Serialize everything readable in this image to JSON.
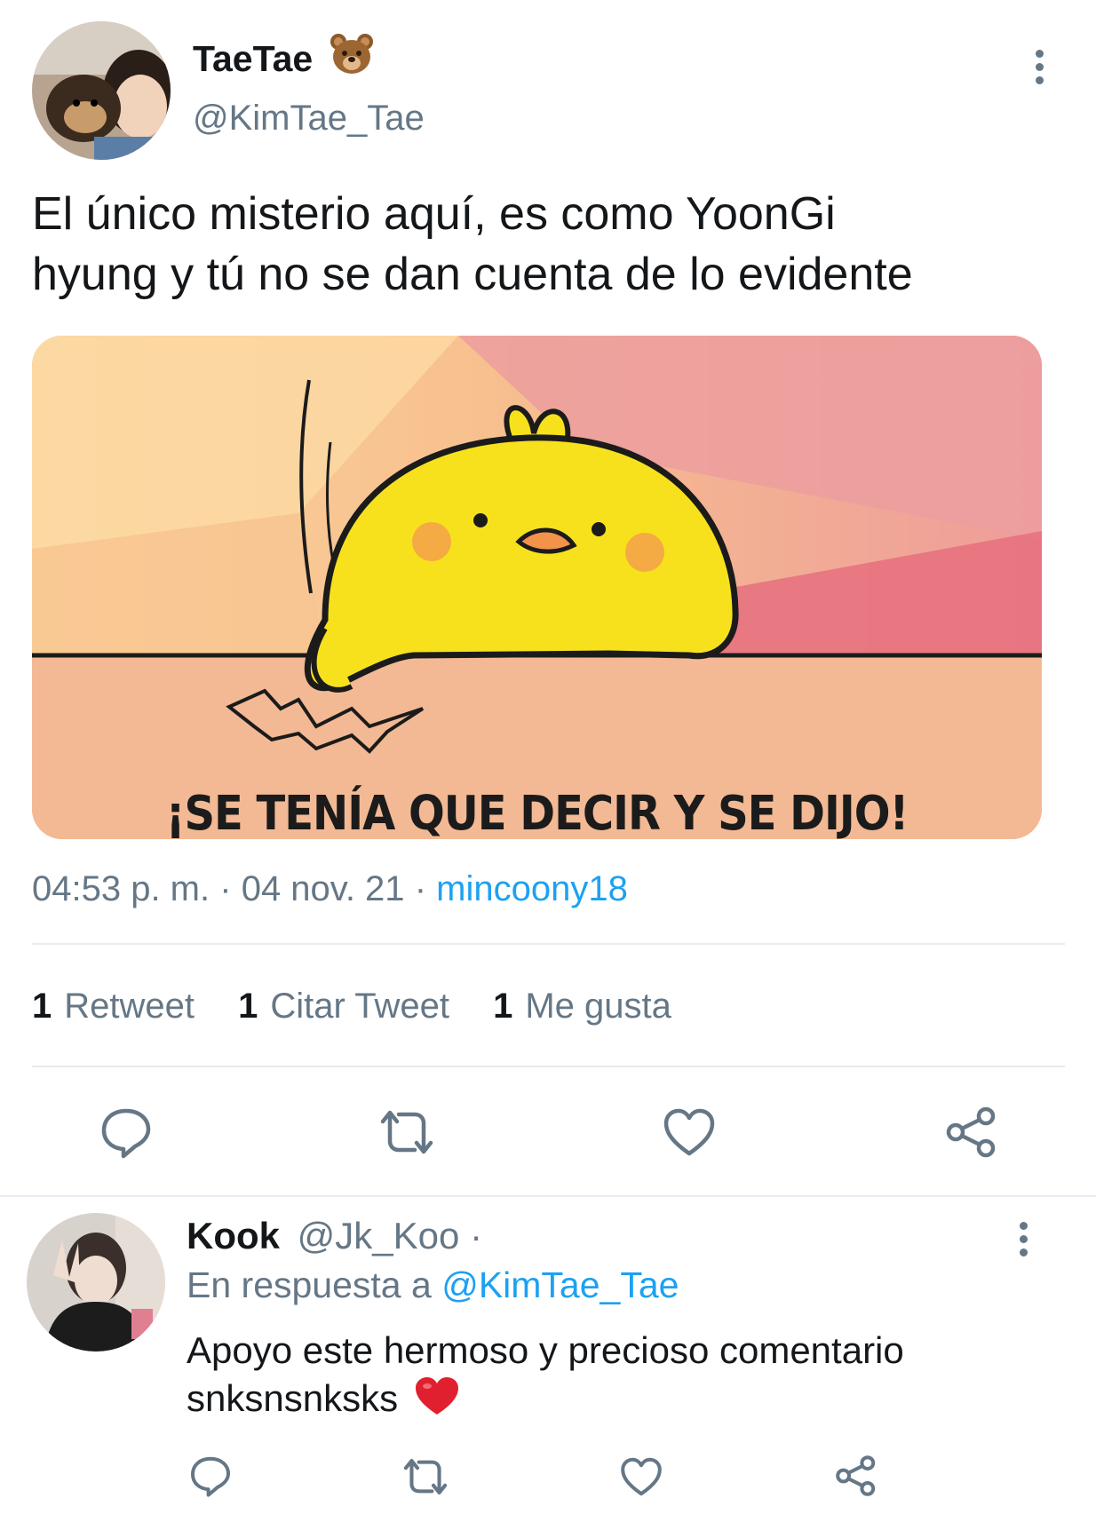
{
  "tweet": {
    "author_name": "TaeTae",
    "author_emoji": "bear-face",
    "author_handle": "@KimTae_Tae",
    "text_line1": "El único misterio aquí, es como YoonGi",
    "text_line2": "hyung y tú no se dan cuenta de lo evidente",
    "media_caption": "¡SE TENÍA QUE DECIR Y SE DIJO!",
    "time": "04:53 p. m.",
    "date": "04 nov. 21",
    "separator": "·",
    "source": "mincoony18",
    "stats": {
      "retweets_count": "1",
      "retweets_label": "Retweet",
      "quotes_count": "1",
      "quotes_label": "Citar Tweet",
      "likes_count": "1",
      "likes_label": "Me gusta"
    }
  },
  "reply": {
    "author_name": "Kook",
    "author_handle": "@Jk_Koo",
    "handle_separator": "·",
    "in_reply_prefix": "En respuesta a",
    "in_reply_handle": "@KimTae_Tae",
    "text_line1": "Apoyo este hermoso y precioso comentario",
    "text_line2": "snksnsnksks",
    "text_emoji": "red-heart"
  },
  "colors": {
    "link": "#1da1f2",
    "muted": "#657786",
    "divider": "#e6ecf0",
    "chick": "#f7e11c"
  },
  "icons": [
    "more-icon",
    "reply-icon",
    "retweet-icon",
    "like-icon",
    "share-icon"
  ]
}
